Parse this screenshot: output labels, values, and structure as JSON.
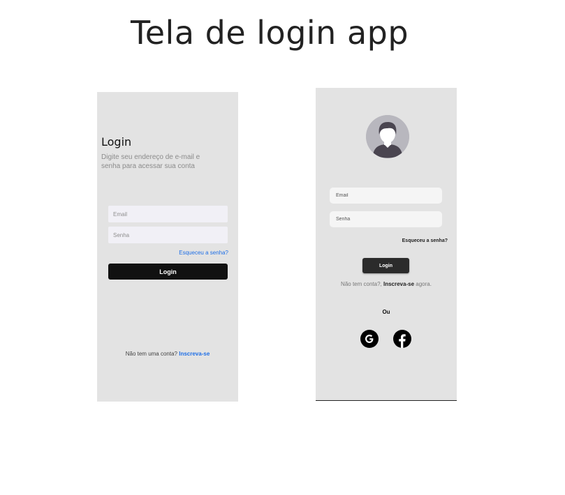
{
  "page_title": "Tela de login app",
  "screen1": {
    "heading": "Login",
    "subtitle": "Digite seu endereço de e-mail e senha para acessar sua conta",
    "email_placeholder": "Email",
    "password_placeholder": "Senha",
    "forgot_link": "Esqueceu a senha?",
    "login_button": "Login",
    "signup_prompt": "Não tem uma conta?",
    "signup_link": "Inscreva-se"
  },
  "screen2": {
    "avatar_icon": "user-avatar-icon",
    "email_placeholder": "Email",
    "password_placeholder": "Senha",
    "forgot_link": "Esqueceu a senha?",
    "login_button": "Login",
    "signup_prompt": "Não tem conta?,",
    "signup_link": "Inscreva-se",
    "signup_suffix": "agora.",
    "or_label": "Ou",
    "social_icons": [
      "google-icon",
      "facebook-icon"
    ]
  },
  "colors": {
    "screen_bg": "#e3e3e3",
    "button_dark": "#111111",
    "link_blue": "#1f6fe6",
    "input_bg": "#f1f0f6"
  }
}
